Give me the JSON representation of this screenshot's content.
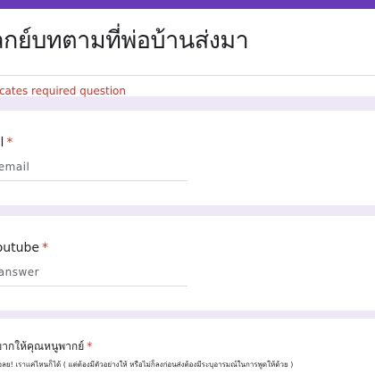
{
  "form": {
    "title": "ลกย์บทตามที่พ่อบ้านส่งมา",
    "required_note": "dicates required question"
  },
  "questions": [
    {
      "label": "ail",
      "required_mark": "*",
      "placeholder": "r email"
    },
    {
      "label": "Youtube",
      "required_mark": "*",
      "placeholder": "r answer"
    },
    {
      "label": "อยากให้คุณหนูพากย์",
      "required_mark": "*",
      "description": "โล้อลย! เราแค่ไหนก็ได้ ( แต่ต้องมีตัวอย่างให้ หรือไม่ก็ลงก่อนส่งต้องมีระบุอารมณ์ในการพูดให้ด้วย )"
    }
  ],
  "colors": {
    "accent": "#673ab7",
    "background": "#ede7f6",
    "required": "#d93025"
  }
}
